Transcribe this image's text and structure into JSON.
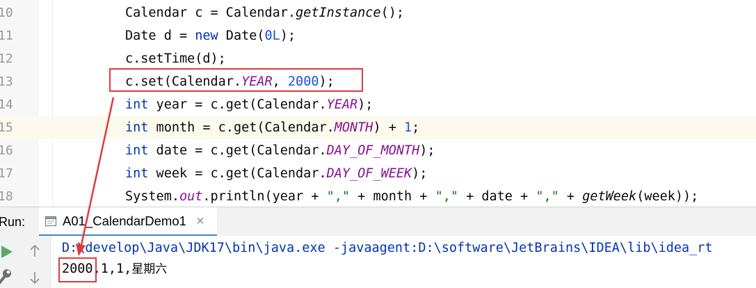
{
  "editor": {
    "lines": [
      {
        "number": "10",
        "tokens": [
          {
            "t": "Calendar c = Calendar."
          },
          {
            "t": "getInstance",
            "c": "meth"
          },
          {
            "t": "();"
          }
        ]
      },
      {
        "number": "11",
        "tokens": [
          {
            "t": "Date d = "
          },
          {
            "t": "new",
            "c": "kw"
          },
          {
            "t": " Date("
          },
          {
            "t": "0L",
            "c": "num"
          },
          {
            "t": ");"
          }
        ]
      },
      {
        "number": "12",
        "tokens": [
          {
            "t": "c.setTime(d);"
          }
        ]
      },
      {
        "number": "13",
        "tokens": [
          {
            "t": "c.set(Calendar."
          },
          {
            "t": "YEAR",
            "c": "const"
          },
          {
            "t": ", "
          },
          {
            "t": "2000",
            "c": "num"
          },
          {
            "t": ");"
          }
        ]
      },
      {
        "number": "14",
        "tokens": [
          {
            "t": "int",
            "c": "kw"
          },
          {
            "t": " year = c.get(Calendar."
          },
          {
            "t": "YEAR",
            "c": "const"
          },
          {
            "t": ");"
          }
        ]
      },
      {
        "number": "15",
        "current": true,
        "tokens": [
          {
            "t": "int",
            "c": "kw"
          },
          {
            "t": " month = c.get(Calendar."
          },
          {
            "t": "MONTH",
            "c": "const"
          },
          {
            "t": ") + "
          },
          {
            "t": "1",
            "c": "num"
          },
          {
            "t": ";"
          }
        ]
      },
      {
        "number": "16",
        "tokens": [
          {
            "t": "int",
            "c": "kw"
          },
          {
            "t": " date = c.get(Calendar."
          },
          {
            "t": "DAY_OF_MONTH",
            "c": "const"
          },
          {
            "t": ");"
          }
        ]
      },
      {
        "number": "17",
        "tokens": [
          {
            "t": "int",
            "c": "kw"
          },
          {
            "t": " week = c.get(Calendar."
          },
          {
            "t": "DAY_OF_WEEK",
            "c": "const"
          },
          {
            "t": ");"
          }
        ]
      },
      {
        "number": "18",
        "tokens": [
          {
            "t": "System."
          },
          {
            "t": "out",
            "c": "fld"
          },
          {
            "t": ".println(year + "
          },
          {
            "t": "\",\"",
            "c": "str"
          },
          {
            "t": " + month + "
          },
          {
            "t": "\",\"",
            "c": "str"
          },
          {
            "t": " + date + "
          },
          {
            "t": "\",\"",
            "c": "str"
          },
          {
            "t": " + "
          },
          {
            "t": "getWeek",
            "c": "meth"
          },
          {
            "t": "(week));"
          }
        ]
      }
    ]
  },
  "run_panel": {
    "label": "Run:",
    "tab_label": "A01_CalendarDemo1",
    "tab_close": "×",
    "icons": {
      "tab": "console-window-icon",
      "rerun": "play-icon",
      "up": "arrow-up-icon",
      "wrench": "wrench-icon",
      "down": "arrow-down-icon"
    }
  },
  "console": {
    "command": "D:\\develop\\Java\\JDK17\\bin\\java.exe -javaagent:D:\\software\\JetBrains\\IDEA\\lib\\idea_rt",
    "output_year": "2000",
    "output_rest": ",1,1,",
    "output_weekday": "星期六"
  },
  "colors": {
    "annotation_red": "#e0393a",
    "keyword_blue": "#0033b3",
    "number_blue": "#1750eb",
    "constant_purple": "#871094",
    "string_green": "#067d17",
    "run_green": "#59a869",
    "tab_underline": "#4083c9"
  }
}
